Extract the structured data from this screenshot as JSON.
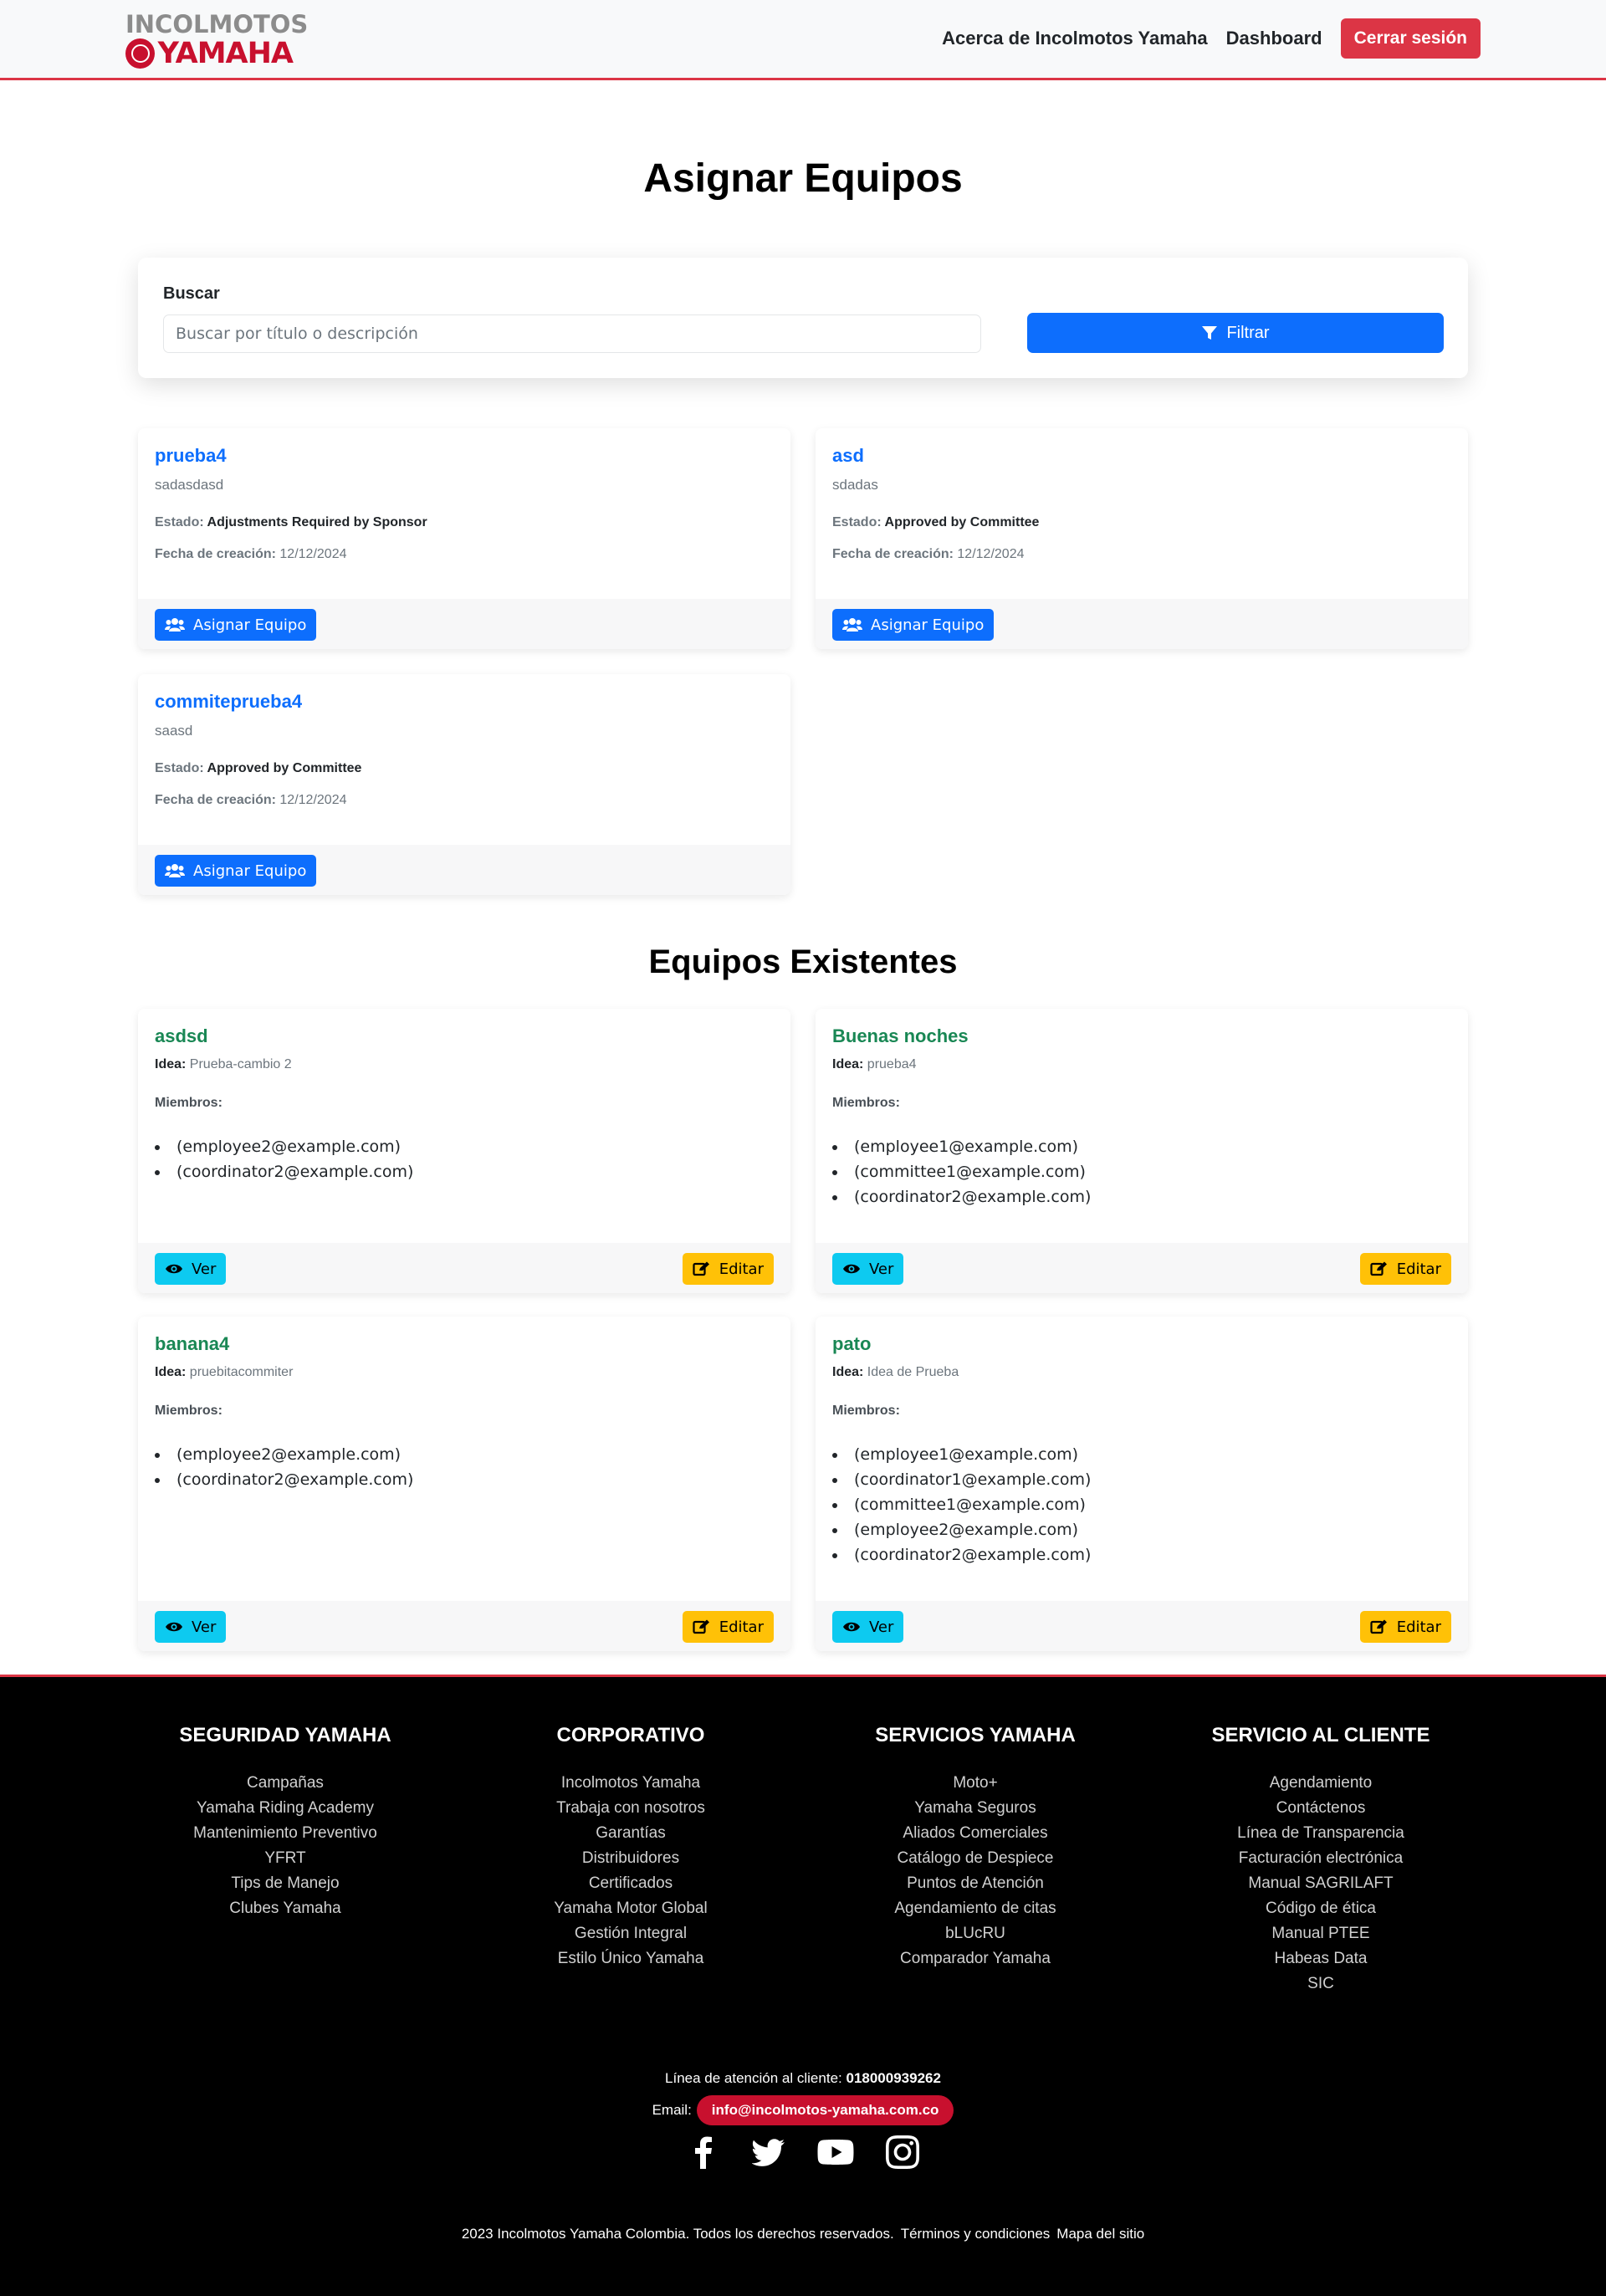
{
  "brand": {
    "top": "INCOLMOTOS",
    "bottom": "YAMAHA"
  },
  "nav": {
    "about": "Acerca de Incolmotos Yamaha",
    "dashboard": "Dashboard",
    "logout": "Cerrar sesión"
  },
  "page_title": "Asignar Equipos",
  "search": {
    "label": "Buscar",
    "placeholder": "Buscar por título o descripción",
    "filter_label": "Filtrar"
  },
  "ideas": [
    {
      "title": "prueba4",
      "description": "sadasdasd",
      "estado_label": "Estado:",
      "estado": "Adjustments Required by Sponsor",
      "fecha_label": "Fecha de creación:",
      "fecha": "12/12/2024",
      "button": "Asignar Equipo"
    },
    {
      "title": "asd",
      "description": "sdadas",
      "estado_label": "Estado:",
      "estado": "Approved by Committee",
      "fecha_label": "Fecha de creación:",
      "fecha": "12/12/2024",
      "button": "Asignar Equipo"
    },
    {
      "title": "commiteprueba4",
      "description": "saasd",
      "estado_label": "Estado:",
      "estado": "Approved by Committee",
      "fecha_label": "Fecha de creación:",
      "fecha": "12/12/2024",
      "button": "Asignar Equipo"
    }
  ],
  "teams_title": "Equipos Existentes",
  "teams": [
    {
      "name": "asdsd",
      "idea_label": "Idea:",
      "idea": "Prueba-cambio 2",
      "members_label": "Miembros:",
      "members": [
        "(employee2@example.com)",
        "(coordinator2@example.com)"
      ],
      "view": "Ver",
      "edit": "Editar"
    },
    {
      "name": "Buenas noches",
      "idea_label": "Idea:",
      "idea": "prueba4",
      "members_label": "Miembros:",
      "members": [
        "(employee1@example.com)",
        "(committee1@example.com)",
        "(coordinator2@example.com)"
      ],
      "view": "Ver",
      "edit": "Editar"
    },
    {
      "name": "banana4",
      "idea_label": "Idea:",
      "idea": "pruebitacommiter",
      "members_label": "Miembros:",
      "members": [
        "(employee2@example.com)",
        "(coordinator2@example.com)"
      ],
      "view": "Ver",
      "edit": "Editar"
    },
    {
      "name": "pato",
      "idea_label": "Idea:",
      "idea": "Idea de Prueba",
      "members_label": "Miembros:",
      "members": [
        "(employee1@example.com)",
        "(coordinator1@example.com)",
        "(committee1@example.com)",
        "(employee2@example.com)",
        "(coordinator2@example.com)"
      ],
      "view": "Ver",
      "edit": "Editar"
    }
  ],
  "footer": {
    "columns": [
      {
        "title": "SEGURIDAD YAMAHA",
        "links": [
          "Campañas",
          "Yamaha Riding Academy",
          "Mantenimiento Preventivo",
          "YFRT",
          "Tips de Manejo",
          "Clubes Yamaha"
        ]
      },
      {
        "title": "CORPORATIVO",
        "links": [
          "Incolmotos Yamaha",
          "Trabaja con nosotros",
          "Garantías",
          "Distribuidores",
          "Certificados",
          "Yamaha Motor Global",
          "Gestión Integral",
          "Estilo Único Yamaha"
        ]
      },
      {
        "title": "SERVICIOS YAMAHA",
        "links": [
          "Moto+",
          "Yamaha Seguros",
          "Aliados Comerciales",
          "Catálogo de Despiece",
          "Puntos de Atención",
          "Agendamiento de citas",
          "bLUcRU",
          "Comparador Yamaha"
        ]
      },
      {
        "title": "SERVICIO AL CLIENTE",
        "links": [
          "Agendamiento",
          "Contáctenos",
          "Línea de Transparencia",
          "Facturación electrónica",
          "Manual SAGRILAFT",
          "Código de ética",
          "Manual PTEE",
          "Habeas Data",
          "SIC"
        ]
      }
    ],
    "contact_label": "Línea de atención al cliente:",
    "phone": "018000939262",
    "email_label": "Email:",
    "email": "info@incolmotos-yamaha.com.co",
    "copyright": "2023 Incolmotos Yamaha Colombia. Todos los derechos reservados.",
    "terms": "Términos y condiciones",
    "sitemap": "Mapa del sitio"
  },
  "icons": {
    "filter": "filter-icon",
    "assign": "users-icon",
    "view": "eye-icon",
    "edit": "edit-icon",
    "socials": [
      "facebook-icon",
      "twitter-icon",
      "youtube-icon",
      "instagram-icon"
    ]
  },
  "colors": {
    "primary": "#0d6efd",
    "danger": "#dc3545",
    "success": "#198754",
    "info": "#0dcaf0",
    "warning": "#ffc107",
    "brand_red": "#c8102e"
  }
}
